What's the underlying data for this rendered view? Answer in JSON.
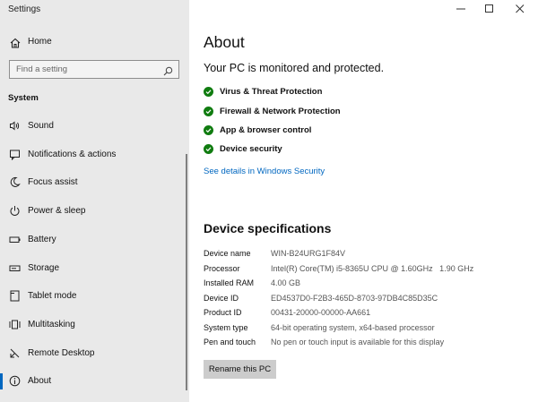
{
  "window": {
    "title": "Settings",
    "controls": [
      "minimize-icon",
      "maximize-icon",
      "close-icon"
    ]
  },
  "sidebar": {
    "home_label": "Home",
    "search_placeholder": "Find a setting",
    "section_header": "System",
    "items": [
      {
        "label": "Sound",
        "icon": "speaker-icon"
      },
      {
        "label": "Notifications & actions",
        "icon": "notification-icon"
      },
      {
        "label": "Focus assist",
        "icon": "moon-icon"
      },
      {
        "label": "Power & sleep",
        "icon": "power-icon"
      },
      {
        "label": "Battery",
        "icon": "battery-icon"
      },
      {
        "label": "Storage",
        "icon": "storage-icon"
      },
      {
        "label": "Tablet mode",
        "icon": "tablet-icon"
      },
      {
        "label": "Multitasking",
        "icon": "multitasking-icon"
      },
      {
        "label": "Remote Desktop",
        "icon": "remote-desktop-icon"
      },
      {
        "label": "About",
        "icon": "info-icon",
        "selected": true
      }
    ]
  },
  "main": {
    "title": "About",
    "protection_heading": "Your PC is monitored and protected.",
    "protection_items": [
      "Virus & Threat Protection",
      "Firewall & Network Protection",
      "App & browser control",
      "Device security"
    ],
    "security_link": "See details in Windows Security",
    "spec_heading": "Device specifications",
    "specs": [
      {
        "key": "Device name",
        "value": "WIN-B24URG1F84V"
      },
      {
        "key": "Processor",
        "value": "Intel(R) Core(TM) i5-8365U CPU @ 1.60GHz   1.90 GHz"
      },
      {
        "key": "Installed RAM",
        "value": "4.00 GB"
      },
      {
        "key": "Device ID",
        "value": "ED4537D0-F2B3-465D-8703-97DB4C85D35C"
      },
      {
        "key": "Product ID",
        "value": "00431-20000-00000-AA661"
      },
      {
        "key": "System type",
        "value": "64-bit operating system, x64-based processor"
      },
      {
        "key": "Pen and touch",
        "value": "No pen or touch input is available for this display"
      }
    ],
    "rename_button": "Rename this PC"
  },
  "colors": {
    "sidebar_bg": "#e9e9e9",
    "accent": "#0067c0",
    "check_green": "#107c10",
    "button_bg": "#cccccc"
  }
}
